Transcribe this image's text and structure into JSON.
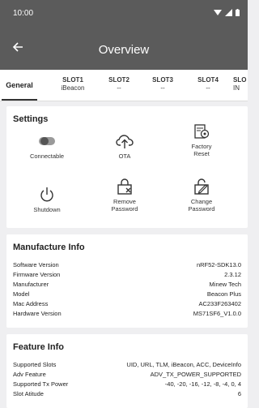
{
  "status_bar": {
    "time": "10:00",
    "icons": "▾◢▮"
  },
  "app_bar": {
    "title": "Overview"
  },
  "tabs": [
    {
      "line1": "General",
      "line2": ""
    },
    {
      "line1": "SLOT1",
      "line2": "iBeacon"
    },
    {
      "line1": "SLOT2",
      "line2": "--"
    },
    {
      "line1": "SLOT3",
      "line2": "--"
    },
    {
      "line1": "SLOT4",
      "line2": "--"
    },
    {
      "line1": "SLO",
      "line2": "IN"
    }
  ],
  "settings": {
    "title": "Settings",
    "items": [
      {
        "label1": "Connectable",
        "label2": "",
        "icon": "toggle-icon"
      },
      {
        "label1": "OTA",
        "label2": "",
        "icon": "cloud-upload-icon"
      },
      {
        "label1": "Factory",
        "label2": "Reset",
        "icon": "factory-reset-icon"
      },
      {
        "label1": "Shutdown",
        "label2": "",
        "icon": "power-icon"
      },
      {
        "label1": "Remove",
        "label2": "Password",
        "icon": "remove-password-icon"
      },
      {
        "label1": "Change",
        "label2": "Password",
        "icon": "change-password-icon"
      }
    ]
  },
  "manufacture": {
    "title": "Manufacture Info",
    "rows": [
      {
        "key": "Software Version",
        "value": "nRF52-SDK13.0"
      },
      {
        "key": "Firmware Version",
        "value": "2.3.12"
      },
      {
        "key": "Manufacturer",
        "value": "Minew Tech"
      },
      {
        "key": "Model",
        "value": "Beacon Plus"
      },
      {
        "key": "Mac Address",
        "value": "AC233F263402"
      },
      {
        "key": "Hardware Version",
        "value": "MS71SF6_V1.0.0"
      }
    ]
  },
  "feature": {
    "title": "Feature Info",
    "rows": [
      {
        "key": "Supported Slots",
        "value": "UID, URL, TLM, iBeacon, ACC, DeviceInfo"
      },
      {
        "key": "Adv Feature",
        "value": "ADV_TX_POWER_SUPPORTED"
      },
      {
        "key": "Supported Tx Power",
        "value": "-40, -20, -16, -12, -8, -4, 0, 4"
      },
      {
        "key": "Slot Atitude",
        "value": "6"
      }
    ]
  }
}
